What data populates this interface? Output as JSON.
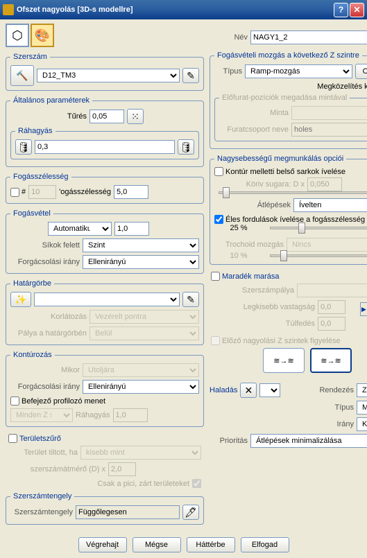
{
  "title": "Ofszet nagyolás [3D-s modellre]",
  "name_label": "Név",
  "name_value": "NAGY1_2",
  "szerszam": {
    "legend": "Szerszám",
    "value": "D12_TM3"
  },
  "altalanos": {
    "legend": "Általános paraméterek",
    "tures_label": "Tűrés",
    "tures_value": "0,05"
  },
  "rahagyas": {
    "legend": "Ráhagyás",
    "value": "0,3"
  },
  "fogasszelesseg": {
    "legend": "Fogásszélesség",
    "hash": "#",
    "hash_value": "10",
    "label": "'ogásszélesség",
    "value": "5,0"
  },
  "fogasvetel": {
    "legend": "Fogásvétel",
    "mode": "Automatikus",
    "mode_value": "1,0",
    "sikok_label": "Síkok felett",
    "sikok_value": "Szint",
    "irany_label": "Forgácsolási irány",
    "irany_value": "Ellenirányú"
  },
  "hatargorbe": {
    "legend": "Határgörbe",
    "korl_label": "Korlátozás",
    "korl_value": "Vezérelt pontra",
    "palya_label": "Pálya a határgörbén",
    "palya_value": "Belül"
  },
  "konturozas": {
    "legend": "Kontúrozás",
    "mikor_label": "Mikor",
    "mikor_value": "Utoljára",
    "irany_label": "Forgácsolási irány",
    "irany_value": "Ellenirányú",
    "befejezo": "Befejező profilozó menet",
    "minden_value": "Minden Z szir",
    "rahagyas_label": "Ráhagyás",
    "rahagyas_value": "1,0"
  },
  "teruletszuro": {
    "label": "Területszűrő",
    "tiltott_label": "Terület tiltott, ha",
    "tiltott_value": "kisebb mint",
    "szersz_label": "szerszámátmérő (D) x",
    "szersz_value": "2,0",
    "csak_label": "Csak a pici, zárt területeket"
  },
  "szerszamtengely": {
    "legend": "Szerszámtengely",
    "label": "Szerszámtengely",
    "value": "Függőlegesen"
  },
  "fogasveteli_mozgas": {
    "legend": "Fogásvételi mozgás a következő Z szintre",
    "tipus_label": "Típus",
    "tipus_value": "Ramp-mozgás",
    "opciok": "Opciók...",
    "megkozelites": "Megközelítés kívülről",
    "elofurat_legend": "Előfurat-pozíciók megadása mintával",
    "minta_label": "Minta",
    "furat_label": "Furatcsoport neve",
    "furat_ph": "holes"
  },
  "nagysebesseg": {
    "legend": "Nagysebességű megmunkálás opciói",
    "kontur": "Kontúr melletti belső sarkok ívelése",
    "koriv_label": "Köriv sugara: D x",
    "koriv_value": "0,050",
    "atlepesek_label": "Átlépések",
    "atlepesek_value": "Ívelten",
    "eles": "Éles fordulások ívelése a fogásszélesség",
    "eles_pct": "25 %",
    "trochoid_label": "Trochoid mozgás",
    "trochoid_value": "Nincs",
    "trochoid_pct": "10 %"
  },
  "maradek": {
    "label": "Maradék marása",
    "szersz_label": "Szerszámpálya",
    "legkisebb_label": "Legkisebb vastagság",
    "legkisebb_value": "0,0",
    "tulfedes_label": "Túlfedés",
    "tulfedes_value": "0,0"
  },
  "elozo": {
    "label": "Előző nagyolási Z szintek figyelése"
  },
  "haladas": {
    "label": "Haladás"
  },
  "right_bottom": {
    "rendezes_label": "Rendezés",
    "rendezes_value": "Zseb",
    "tipus_label": "Típus",
    "tipus_value": "Mind",
    "irany_label": "Irány",
    "irany_value": "Kívülről be",
    "prioritas_label": "Prioritás",
    "prioritas_value": "Átlépések minimalizálása"
  },
  "footer": {
    "vegrehajt": "Végrehajt",
    "megse": "Mégse",
    "hatterbe": "Háttérbe",
    "elfogad": "Elfogad"
  }
}
